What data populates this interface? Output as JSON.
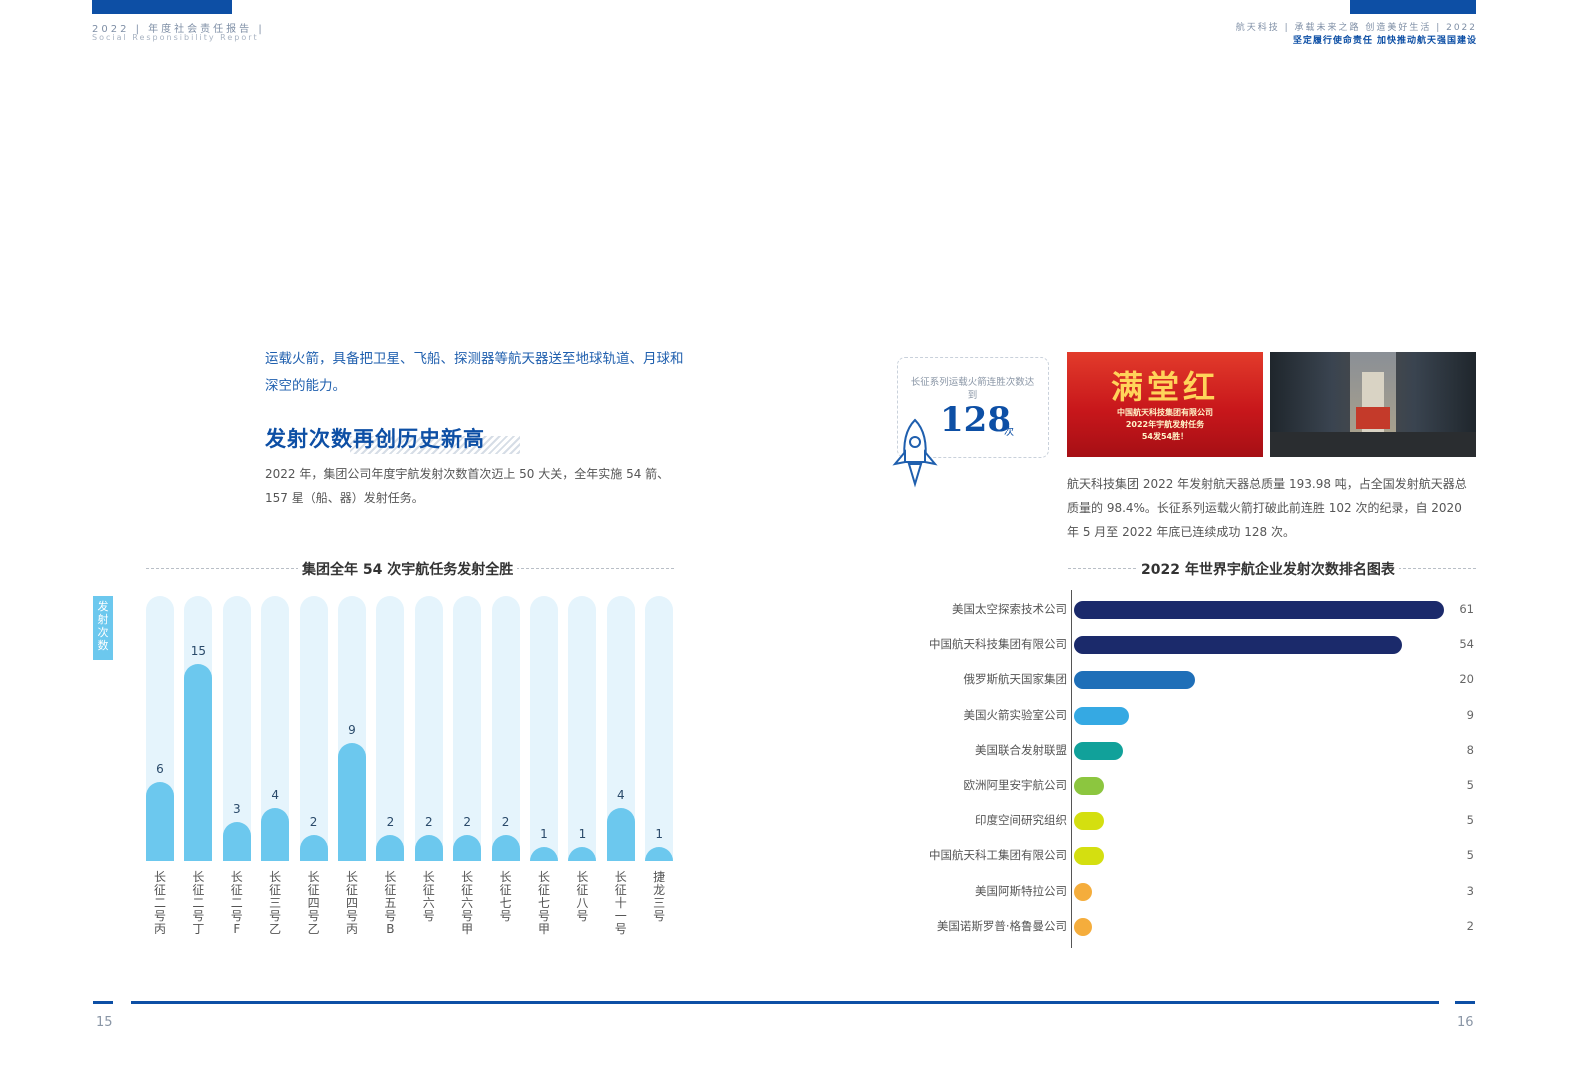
{
  "header": {
    "left_title": "2022 | 年度社会责任报告 |",
    "left_subtitle": "Social Responsibility Report",
    "right_title": "航天科技 | 承载未来之路 创造美好生活 | 2022",
    "right_subtitle": "坚定履行使命责任 加快推动航天强国建设"
  },
  "left_page": {
    "intro": "运载火箭，具备把卫星、飞船、探测器等航天器送至地球轨道、月球和深空的能力。",
    "section_title": "发射次数再创历史新高",
    "paragraph": "2022 年，集团公司年度宇航发射次数首次迈上 50 大关，全年实施 54 箭、157 星（船、器）发射任务。",
    "chart_title": "集团全年 54 次宇航任务发射全胜",
    "y_axis_label": "发射次数",
    "page_number": "15"
  },
  "right_page": {
    "stat_label": "长征系列运载火箭连胜次数达到",
    "stat_value": "128",
    "stat_unit": "次",
    "photo1_big": "满堂红",
    "photo1_line1": "中国航天科技集团有限公司",
    "photo1_line2": "2022年宇航发射任务",
    "photo1_line3": "54发54胜！",
    "paragraph": "航天科技集团 2022 年发射航天器总质量 193.98 吨，占全国发射航天器总质量的 98.4%。长征系列运载火箭打破此前连胜 102 次的纪录，自 2020 年 5 月至 2022 年底已连续成功 128 次。",
    "chart_title": "2022 年世界宇航企业发射次数排名图表",
    "page_number": "16"
  },
  "chart_data": [
    {
      "type": "bar",
      "title": "集团全年 54 次宇航任务发射全胜",
      "ylabel": "发射次数",
      "categories": [
        "长征二号丙",
        "长征二号丁",
        "长征二号F",
        "长征三号乙",
        "长征四号乙",
        "长征四号丙",
        "长征五号B",
        "长征六号",
        "长征六号甲",
        "长征七号",
        "长征七号甲",
        "长征八号",
        "长征十一号",
        "捷龙三号"
      ],
      "values": [
        6,
        15,
        3,
        4,
        2,
        9,
        2,
        2,
        2,
        2,
        1,
        1,
        4,
        1
      ],
      "ylim": [
        0,
        15
      ],
      "color": "#6cc8ee",
      "track_color": "#e5f4fc"
    },
    {
      "type": "bar",
      "orientation": "horizontal",
      "title": "2022 年世界宇航企业发射次数排名图表",
      "categories": [
        "美国太空探索技术公司",
        "中国航天科技集团有限公司",
        "俄罗斯航天国家集团",
        "美国火箭实验室公司",
        "美国联合发射联盟",
        "欧洲阿里安宇航公司",
        "印度空间研究组织",
        "中国航天科工集团有限公司",
        "美国阿斯特拉公司",
        "美国诺斯罗普·格鲁曼公司"
      ],
      "values": [
        61,
        54,
        20,
        9,
        8,
        5,
        5,
        5,
        3,
        2
      ],
      "colors": [
        "#1b2a6b",
        "#1b2a6b",
        "#1f6fb8",
        "#35a9e3",
        "#11a19a",
        "#8cc63f",
        "#d4df10",
        "#d4df10",
        "#f5ad3c",
        "#f5ad3c"
      ],
      "xlim": [
        0,
        61
      ]
    }
  ]
}
